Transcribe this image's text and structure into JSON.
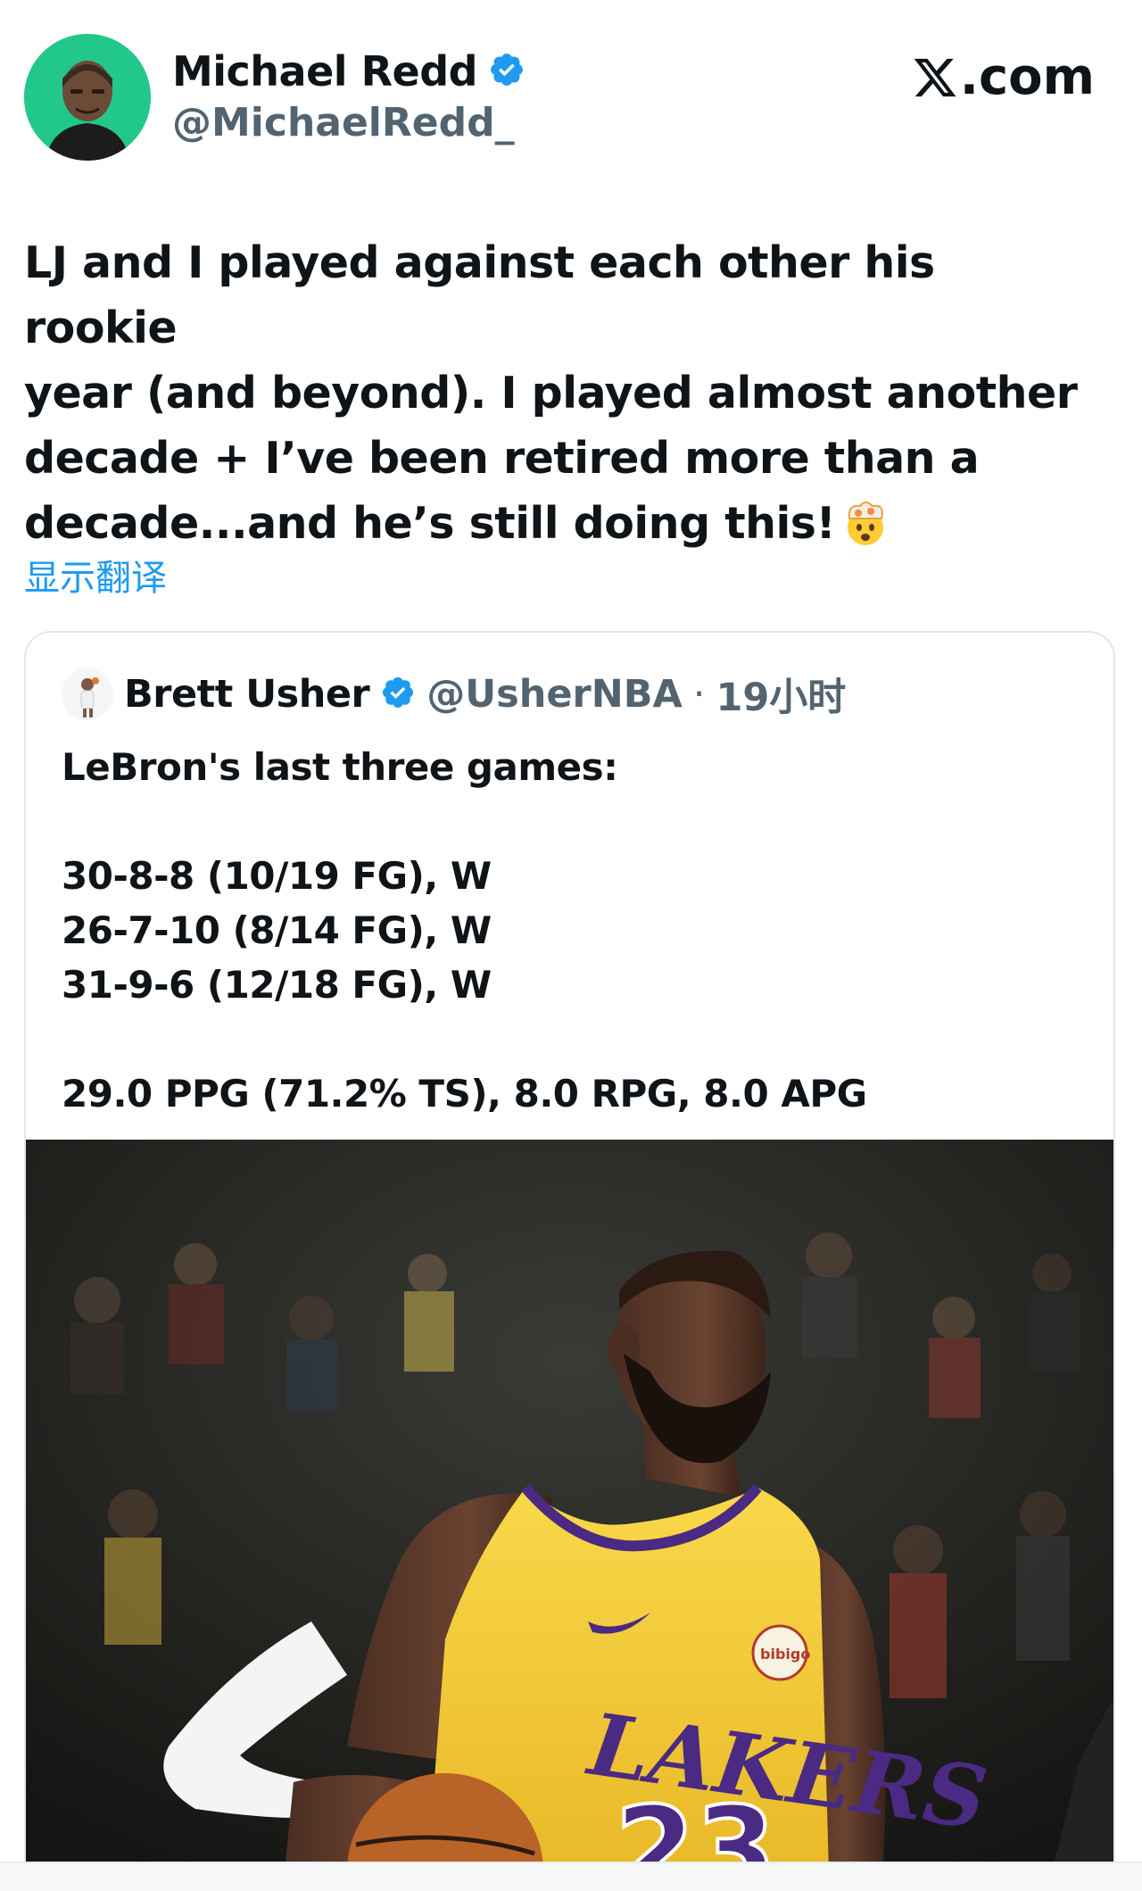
{
  "author": {
    "name": "Michael Redd",
    "handle": "@MichaelRedd_",
    "verified": true,
    "avatar": "avatar-photo"
  },
  "site_label": ".com",
  "tweet": {
    "text_lines": [
      "LJ and I played against each other his rookie",
      "year (and beyond). I played almost another",
      "decade + I’ve been retired more than a",
      "decade...and he’s still doing this!"
    ],
    "emoji": "exploding-head-emoji"
  },
  "translate_label": "显示翻译",
  "quoted": {
    "name": "Brett Usher",
    "handle": "@UsherNBA",
    "separator": "·",
    "time": "19小时",
    "verified": true,
    "lines": [
      "LeBron's last three games:",
      "",
      "30-8-8 (10/19 FG), W",
      "26-7-10 (8/14 FG), W",
      "31-9-6 (12/18 FG), W",
      "",
      "29.0 PPG (71.2% TS), 8.0 RPG, 8.0 APG"
    ],
    "image": {
      "description_icon": "basketball-player-photo",
      "jersey_text": "LAKERS",
      "jersey_number": "23",
      "sponsor_patch": "bibigo"
    }
  },
  "colors": {
    "accent": "#1d9bf0",
    "avatar_bg": "#22c88a",
    "text": "#0f1419",
    "muted": "#536471",
    "jersey": "#f5c832",
    "jersey_purple": "#4a2a82"
  }
}
